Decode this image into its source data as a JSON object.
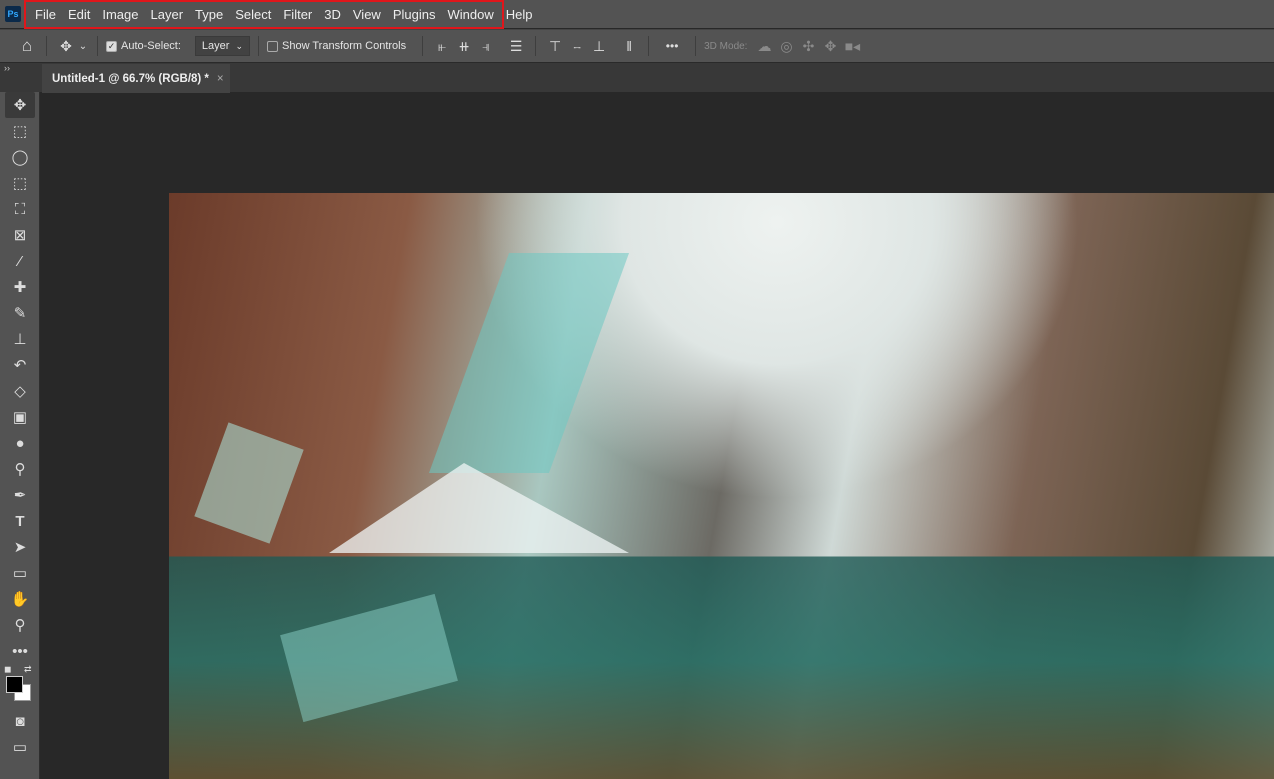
{
  "app": {
    "logo": "Ps"
  },
  "menu": [
    "File",
    "Edit",
    "Image",
    "Layer",
    "Type",
    "Select",
    "Filter",
    "3D",
    "View",
    "Plugins",
    "Window",
    "Help"
  ],
  "options": {
    "auto_select_label": "Auto-Select:",
    "auto_select_checked": true,
    "layer_dropdown": "Layer",
    "show_transform_label": "Show Transform Controls",
    "show_transform_checked": false,
    "more": "•••",
    "mode_label": "3D Mode:"
  },
  "document_tab": {
    "title": "Untitled-1 @ 66.7% (RGB/8) *",
    "close": "×"
  },
  "panel_collapse": "››",
  "tools": [
    "move",
    "rectangular-marquee",
    "lasso",
    "object-selection",
    "crop",
    "frame",
    "eyedropper",
    "spot-healing-brush",
    "brush",
    "clone-stamp",
    "history-brush",
    "eraser",
    "gradient",
    "blur",
    "dodge",
    "pen",
    "type",
    "path-selection",
    "rectangle",
    "hand",
    "zoom",
    "more-tools"
  ],
  "colors": {
    "foreground": "#000000",
    "background": "#ffffff",
    "highlight": "#e0161b"
  }
}
